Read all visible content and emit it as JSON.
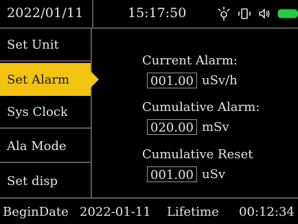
{
  "status_bar": {
    "date": "2022/01/11",
    "time": "15:17:50",
    "icons": [
      "light-icon",
      "vibrate-icon",
      "speaker-icon",
      "battery-icon"
    ],
    "battery_color": "#22cc44"
  },
  "sidebar": {
    "items": [
      {
        "label": "Set Unit",
        "active": false
      },
      {
        "label": "Set Alarm",
        "active": true
      },
      {
        "label": "Sys Clock",
        "active": false
      },
      {
        "label": "Ala Mode",
        "active": false
      },
      {
        "label": "Set disp",
        "active": false
      }
    ],
    "active_color": "#f3c312"
  },
  "main": {
    "current_alarm": {
      "label": "Current Alarm:",
      "value": "001.00",
      "unit": "uSv/h"
    },
    "cumulative_alarm": {
      "label": "Cumulative Alarm:",
      "value": "020.00",
      "unit": "mSv"
    },
    "cumulative_reset": {
      "label": "Cumulative Reset",
      "value": "001.00",
      "unit": "uSv"
    }
  },
  "footer": {
    "begin_label": "BeginDate",
    "begin_date": "2022-01-11",
    "lifetime_label": "Lifetime",
    "lifetime_value": "00:12:34"
  }
}
